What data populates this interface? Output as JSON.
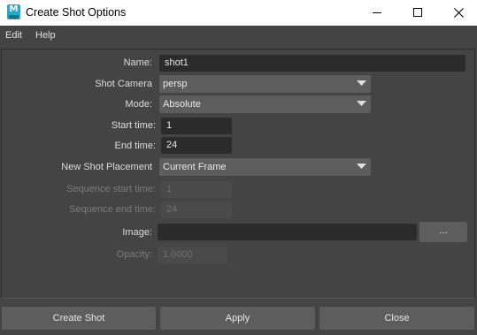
{
  "window": {
    "title": "Create Shot Options",
    "icon_letter": "M"
  },
  "menu": {
    "items": [
      "Edit",
      "Help"
    ]
  },
  "form": {
    "name": {
      "label": "Name:",
      "value": "shot1"
    },
    "shot_camera": {
      "label": "Shot Camera",
      "value": "persp"
    },
    "mode": {
      "label": "Mode:",
      "value": "Absolute"
    },
    "start_time": {
      "label": "Start time:",
      "value": "1"
    },
    "end_time": {
      "label": "End time:",
      "value": "24"
    },
    "new_shot_placement": {
      "label": "New Shot Placement",
      "value": "Current Frame"
    },
    "sequence_start_time": {
      "label": "Sequence start time:",
      "value": "1"
    },
    "sequence_end_time": {
      "label": "Sequence end time:",
      "value": "24"
    },
    "image": {
      "label": "Image:",
      "value": "",
      "browse_label": "..."
    },
    "opacity": {
      "label": "Opacity:",
      "value": "1.0000"
    }
  },
  "buttons": {
    "create_shot": "Create Shot",
    "apply": "Apply",
    "close": "Close"
  },
  "colors": {
    "background": "#444444",
    "field": "#2b2b2b",
    "button": "#5d5d5d",
    "icon_accent": "#2aa7c9"
  },
  "icons": {
    "app": "maya-icon",
    "minimize": "minimize-icon",
    "maximize": "maximize-icon",
    "close": "close-icon",
    "dropdown": "chevron-down-icon"
  }
}
